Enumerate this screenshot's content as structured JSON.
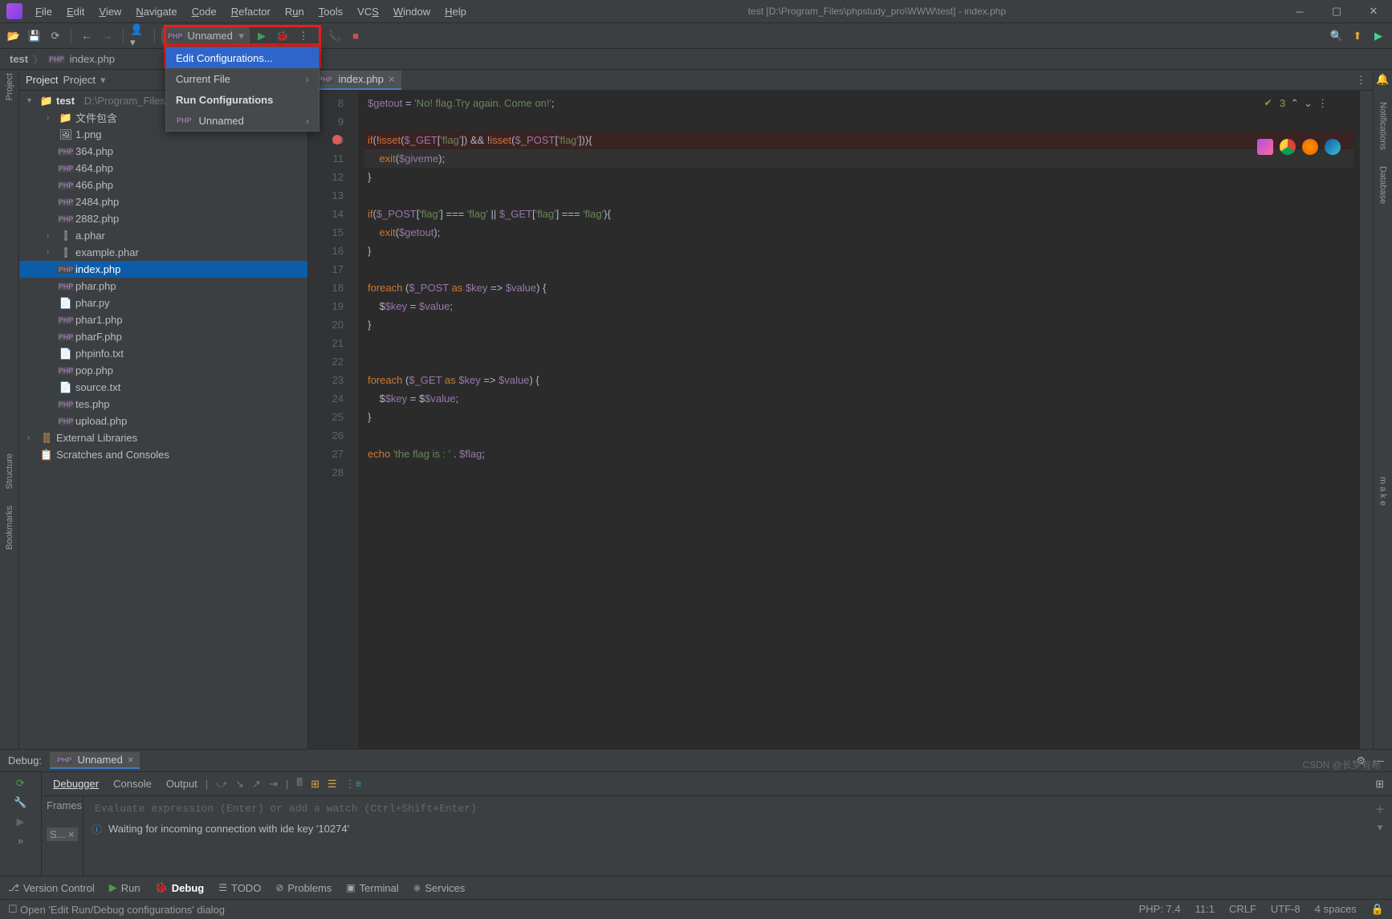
{
  "title": "test [D:\\Program_Files\\phpstudy_pro\\WWW\\test] - index.php",
  "menu": [
    "File",
    "Edit",
    "View",
    "Navigate",
    "Code",
    "Refactor",
    "Run",
    "Tools",
    "VCS",
    "Window",
    "Help"
  ],
  "toolbar": {
    "run_config": "Unnamed"
  },
  "dropdown": {
    "items": [
      {
        "label": "Edit Configurations...",
        "selected": true
      },
      {
        "label": "Current File",
        "submenu": true
      },
      {
        "label": "Run Configurations",
        "header": true
      },
      {
        "label": "Unnamed",
        "icon": "php",
        "submenu": true
      }
    ]
  },
  "breadcrumb": {
    "root": "test",
    "file": "index.php"
  },
  "project": {
    "title": "Project",
    "root": {
      "name": "test",
      "path": "D:\\Program_Files\\"
    },
    "items": [
      {
        "name": "文件包含",
        "type": "folder",
        "depth": 1,
        "expand": true
      },
      {
        "name": "1.png",
        "type": "img",
        "depth": 1
      },
      {
        "name": "364.php",
        "type": "php",
        "depth": 1
      },
      {
        "name": "464.php",
        "type": "php",
        "depth": 1
      },
      {
        "name": "466.php",
        "type": "php",
        "depth": 1
      },
      {
        "name": "2484.php",
        "type": "php",
        "depth": 1
      },
      {
        "name": "2882.php",
        "type": "php",
        "depth": 1
      },
      {
        "name": "a.phar",
        "type": "phar",
        "depth": 1,
        "expand": true
      },
      {
        "name": "example.phar",
        "type": "phar",
        "depth": 1,
        "expand": true
      },
      {
        "name": "index.php",
        "type": "php",
        "depth": 1,
        "selected": true
      },
      {
        "name": "phar.php",
        "type": "php",
        "depth": 1
      },
      {
        "name": "phar.py",
        "type": "py",
        "depth": 1
      },
      {
        "name": "phar1.php",
        "type": "php",
        "depth": 1
      },
      {
        "name": "pharF.php",
        "type": "php",
        "depth": 1
      },
      {
        "name": "phpinfo.txt",
        "type": "txt",
        "depth": 1
      },
      {
        "name": "pop.php",
        "type": "php",
        "depth": 1
      },
      {
        "name": "source.txt",
        "type": "txt",
        "depth": 1
      },
      {
        "name": "tes.php",
        "type": "php",
        "depth": 1
      },
      {
        "name": "upload.php",
        "type": "php",
        "depth": 1
      }
    ],
    "extra": [
      "External Libraries",
      "Scratches and Consoles"
    ]
  },
  "editor": {
    "tab": "index.php",
    "line_start": 8,
    "breakpoint_line": 10,
    "highlight_line": 11,
    "inspection": {
      "checks": "3"
    },
    "lines": [
      {
        "n": 8,
        "t": "$getout = 'No! flag.Try again. Come on!';"
      },
      {
        "n": 9,
        "t": ""
      },
      {
        "n": 10,
        "t": "if(!isset($_GET['flag']) && !isset($_POST['flag'])){"
      },
      {
        "n": 11,
        "t": "    exit($giveme);"
      },
      {
        "n": 12,
        "t": "}"
      },
      {
        "n": 13,
        "t": ""
      },
      {
        "n": 14,
        "t": "if($_POST['flag'] === 'flag' || $_GET['flag'] === 'flag'){"
      },
      {
        "n": 15,
        "t": "    exit($getout);"
      },
      {
        "n": 16,
        "t": "}"
      },
      {
        "n": 17,
        "t": ""
      },
      {
        "n": 18,
        "t": "foreach ($_POST as $key => $value) {"
      },
      {
        "n": 19,
        "t": "    $$key = $value;"
      },
      {
        "n": 20,
        "t": "}"
      },
      {
        "n": 21,
        "t": ""
      },
      {
        "n": 22,
        "t": ""
      },
      {
        "n": 23,
        "t": "foreach ($_GET as $key => $value) {"
      },
      {
        "n": 24,
        "t": "    $$key = $$value;"
      },
      {
        "n": 25,
        "t": "}"
      },
      {
        "n": 26,
        "t": ""
      },
      {
        "n": 27,
        "t": "echo 'the flag is : ' . $flag;"
      },
      {
        "n": 28,
        "t": ""
      }
    ]
  },
  "debug": {
    "title": "Debug:",
    "config": "Unnamed",
    "tabs": [
      "Debugger",
      "Console",
      "Output"
    ],
    "frames_label": "Frames",
    "eval_placeholder": "Evaluate expression (Enter) or add a watch (Ctrl+Shift+Enter)",
    "waiting": "Waiting for incoming connection with ide key '10274'",
    "frame_stack": "S..."
  },
  "bottom_tools": [
    "Version Control",
    "Run",
    "Debug",
    "TODO",
    "Problems",
    "Terminal",
    "Services"
  ],
  "status": {
    "msg": "Open 'Edit Run/Debug configurations' dialog",
    "php": "PHP: 7.4",
    "pos": "11:1",
    "eol": "CRLF",
    "enc": "UTF-8",
    "indent": "4 spaces"
  },
  "side": {
    "left": [
      "Project",
      "Structure",
      "Bookmarks"
    ],
    "right": [
      "Notifications",
      "Database",
      "m a k e"
    ]
  },
  "watermark": "CSDN @长梦有希"
}
